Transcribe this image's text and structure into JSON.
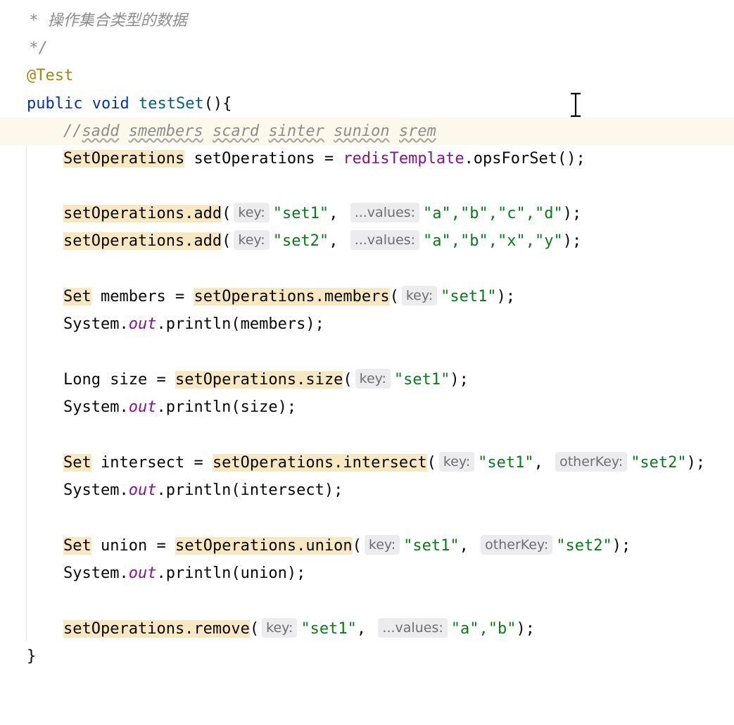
{
  "doc_comment": {
    "line1": " * 操作集合类型的数据",
    "line2": " */"
  },
  "annotation": "@Test",
  "method": {
    "kw_public": "public",
    "kw_void": "void",
    "name": "testSet",
    "open": "(){",
    "close": "}"
  },
  "comment": {
    "prefix": "//",
    "words": [
      "sadd",
      "smembers",
      "scard",
      "sinter",
      "sunion",
      "srem"
    ]
  },
  "decl": {
    "type": "SetOperations",
    "var": "setOperations",
    "eq": " = ",
    "template": "redisTemplate",
    "call": ".opsForSet();"
  },
  "add1": {
    "call": "setOperations.add",
    "key_hint": "key:",
    "key": "\"set1\"",
    "values_hint": "...values:",
    "values": "\"a\",\"b\",\"c\",\"d\"",
    "end": ");"
  },
  "add2": {
    "call": "setOperations.add",
    "key_hint": "key:",
    "key": "\"set2\"",
    "values_hint": "...values:",
    "values": "\"a\",\"b\",\"x\",\"y\"",
    "end": ");"
  },
  "members": {
    "type": "Set",
    "rest": " members = ",
    "call": "setOperations.members",
    "key_hint": "key:",
    "key": "\"set1\"",
    "end": ");"
  },
  "print_members": {
    "system": "System.",
    "out": "out",
    "rest": ".println(members);"
  },
  "size": {
    "type": "Long size = ",
    "call": "setOperations.size",
    "key_hint": "key:",
    "key": "\"set1\"",
    "end": ");"
  },
  "print_size": {
    "system": "System.",
    "out": "out",
    "rest": ".println(size);"
  },
  "intersect": {
    "type": "Set",
    "rest": " intersect = ",
    "call": "setOperations.intersect",
    "key_hint": "key:",
    "key": "\"set1\"",
    "other_hint": "otherKey:",
    "other": "\"set2\"",
    "end": ");"
  },
  "print_intersect": {
    "system": "System.",
    "out": "out",
    "rest": ".println(intersect);"
  },
  "union": {
    "type": "Set",
    "rest": " union = ",
    "call": "setOperations.union",
    "key_hint": "key:",
    "key": "\"set1\"",
    "other_hint": "otherKey:",
    "other": "\"set2\"",
    "end": ");"
  },
  "print_union": {
    "system": "System.",
    "out": "out",
    "rest": ".println(union);"
  },
  "remove": {
    "call": "setOperations.remove",
    "key_hint": "key:",
    "key": "\"set1\"",
    "values_hint": "...values:",
    "values": "\"a\",\"b\"",
    "end": ");"
  },
  "colors": {
    "keyword": "#0033b3",
    "method": "#00627a",
    "string": "#067d17",
    "field": "#871094",
    "annotation": "#9e880d",
    "highlight": "#f8e8c1"
  }
}
